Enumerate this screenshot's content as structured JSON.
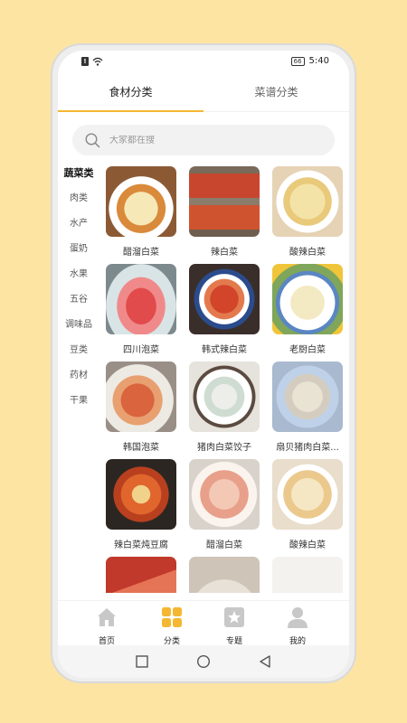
{
  "status_bar": {
    "time": "5:40",
    "battery": "66",
    "icons": [
      "sim-alert-icon",
      "wifi-icon",
      "battery-icon"
    ]
  },
  "tabs": [
    {
      "label": "食材分类",
      "active": true
    },
    {
      "label": "菜谱分类",
      "active": false
    }
  ],
  "search": {
    "placeholder": "大家都在搜",
    "icon": "search-icon"
  },
  "sidebar": {
    "items": [
      {
        "label": "蔬菜类",
        "active": true
      },
      {
        "label": "肉类"
      },
      {
        "label": "水产"
      },
      {
        "label": "蛋奶"
      },
      {
        "label": "水果"
      },
      {
        "label": "五谷"
      },
      {
        "label": "调味品"
      },
      {
        "label": "豆类"
      },
      {
        "label": "药材"
      },
      {
        "label": "干果"
      }
    ]
  },
  "recipes": [
    {
      "name": "醋溜白菜"
    },
    {
      "name": "辣白菜"
    },
    {
      "name": "酸辣白菜"
    },
    {
      "name": "四川泡菜"
    },
    {
      "name": "韩式辣白菜"
    },
    {
      "name": "老厨白菜"
    },
    {
      "name": "韩国泡菜"
    },
    {
      "name": "猪肉白菜饺子"
    },
    {
      "name": "扇贝猪肉白菜..."
    },
    {
      "name": "辣白菜炖豆腐"
    },
    {
      "name": "醋溜白菜"
    },
    {
      "name": "酸辣白菜"
    },
    {
      "name": ""
    },
    {
      "name": ""
    },
    {
      "name": ""
    }
  ],
  "bottom_nav": [
    {
      "label": "首页",
      "icon": "home-icon"
    },
    {
      "label": "分类",
      "icon": "category-icon",
      "active": true
    },
    {
      "label": "专题",
      "icon": "topic-icon"
    },
    {
      "label": "我的",
      "icon": "profile-icon"
    }
  ],
  "colors": {
    "accent": "#F5B731",
    "background": "#FDE4A3",
    "inactive_icon": "#C8C8C8"
  }
}
